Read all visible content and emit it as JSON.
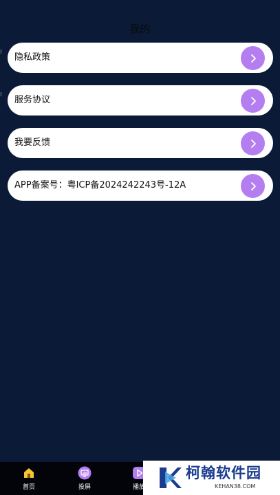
{
  "header": {
    "title": "我的"
  },
  "menu": {
    "items": [
      {
        "label": "隐私政策"
      },
      {
        "label": "服务协议"
      },
      {
        "label": "我要反馈"
      },
      {
        "label": "APP备案号：粤ICP备2024242243号-12A"
      }
    ]
  },
  "tabbar": {
    "tabs": [
      {
        "label": "首页",
        "icon": "home-icon"
      },
      {
        "label": "投屏",
        "icon": "screen-cast-icon"
      },
      {
        "label": "播放",
        "icon": "play-icon"
      }
    ]
  },
  "watermark": {
    "title": "柯翰软件园",
    "subtitle": "KEHAN38.COM"
  },
  "colors": {
    "background": "#0a1a37",
    "accent": "#b47ef0",
    "home_icon": "#f6c530",
    "tabbar": "#020409",
    "watermark_text": "#1c3d8f"
  }
}
